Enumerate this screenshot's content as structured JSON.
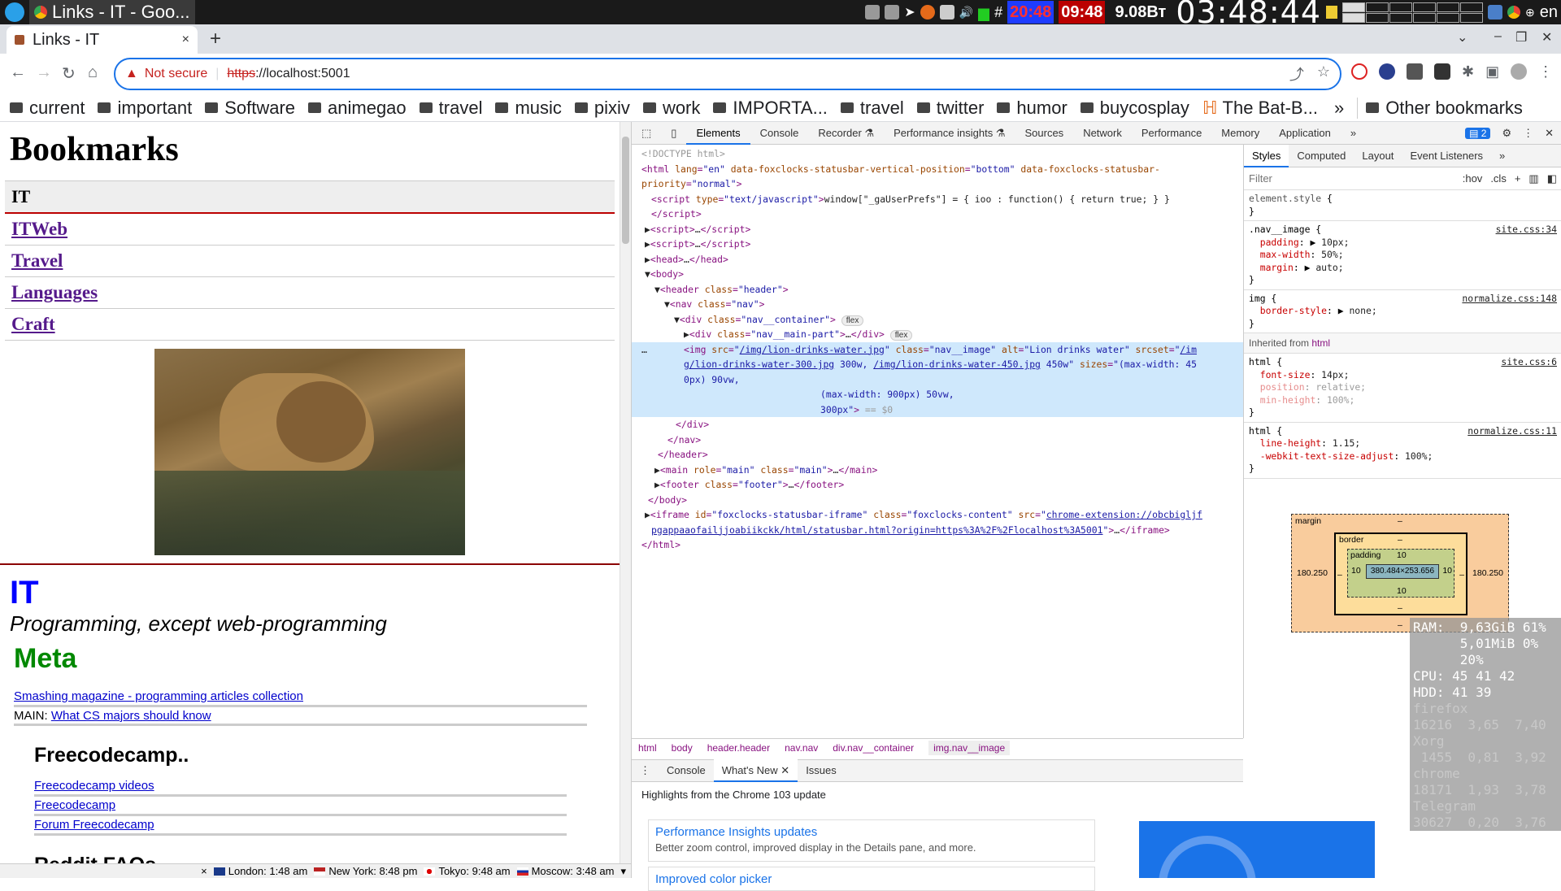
{
  "system_panel": {
    "window_task": "Links - IT - Goo...",
    "clock_a": "20:48",
    "clock_b": "09:48",
    "battery": "9.08Вт",
    "big_clock": "03:48:44",
    "lang": "en"
  },
  "tab": {
    "title": "Links - IT",
    "close": "×"
  },
  "new_tab": "+",
  "address": {
    "warning": "Not secure",
    "scheme": "https",
    "rest": "://localhost:5001"
  },
  "bookmarks": [
    "current",
    "important",
    "Software",
    "animegao",
    "travel",
    "music",
    "pixiv",
    "work",
    "IMPORTA...",
    "travel",
    "twitter",
    "humor",
    "buycosplay",
    "The Bat-B..."
  ],
  "bookmarks_more": "»",
  "bookmarks_other": "Other bookmarks",
  "page": {
    "title": "Bookmarks",
    "nav_selected": "IT",
    "nav_links": [
      "ITWeb",
      "Travel",
      "Languages",
      "Craft"
    ],
    "section_title": "IT",
    "section_subtitle": "Programming, except web-programming",
    "meta_heading": "Meta",
    "link1": "Smashing magazine - programming articles collection",
    "main_prefix": "MAIN: ",
    "link2": "What CS majors should know",
    "h_freecodecamp": "Freecodecamp..",
    "fcc_links": [
      "Freecodecamp videos",
      "Freecodecamp",
      "Forum Freecodecamp"
    ],
    "h_reddit": "Reddit FAQs"
  },
  "foxclocks": [
    {
      "label": "London: 1:48 am"
    },
    {
      "label": "New York: 8:48 pm"
    },
    {
      "label": "Tokyo: 9:48 am"
    },
    {
      "label": "Moscow: 3:48 am"
    }
  ],
  "devtools": {
    "tabs": [
      "Elements",
      "Console",
      "Recorder ⚗",
      "Performance insights ⚗",
      "Sources",
      "Network",
      "Performance",
      "Memory",
      "Application",
      "»"
    ],
    "issues_count": "2",
    "breadcrumbs": [
      "html",
      "body",
      "header.header",
      "nav.nav",
      "div.nav__container",
      "img.nav__image"
    ],
    "drawer_tabs": [
      "Console",
      "What's New",
      "Issues"
    ],
    "whats_new_heading": "Highlights from the Chrome 103 update",
    "cards": [
      {
        "title": "Performance Insights updates",
        "desc": "Better zoom control, improved display in the Details pane, and more."
      },
      {
        "title": "Improved color picker",
        "desc": ""
      }
    ],
    "styles_tabs": [
      "Styles",
      "Computed",
      "Layout",
      "Event Listeners",
      "»"
    ],
    "filter_placeholder": "Filter",
    "hov": ":hov",
    "cls": ".cls",
    "inherited_label": "Inherited from ",
    "inherited_tag": "html",
    "box": {
      "margin_label": "margin",
      "border_label": "border",
      "padding_label": "padding",
      "content": "380.484×253.656",
      "margin_lr": "180.250",
      "padding_val": "10",
      "dash": "–"
    }
  },
  "sysmon": {
    "ram": "RAM:  9,63GiB 61%",
    "swap": "      5,01MiB 0%",
    "cpu_pct": "      20%",
    "cpu": "CPU: 45 41 42",
    "hdd": "HDD: 41 39",
    "firefox": "firefox",
    "firefox_v": "16216  3,65  7,40",
    "xorg": "Xorg",
    "xorg_v": " 1455  0,81  3,92",
    "chrome": "chrome",
    "chrome_v": "18171  1,93  3,78",
    "telegram": "Telegram",
    "telegram_v": "30627  0,20  3,76"
  }
}
